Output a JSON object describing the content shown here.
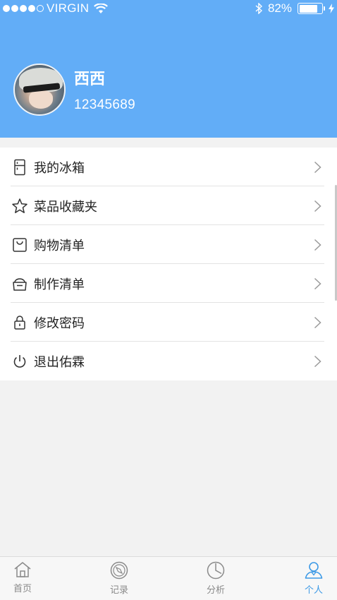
{
  "status_bar": {
    "carrier": "VIRGIN",
    "battery_percent": "82%",
    "battery_level": 0.82
  },
  "profile": {
    "name": "西西",
    "id": "12345689"
  },
  "menu": {
    "items": [
      {
        "label": "我的冰箱",
        "icon": "fridge-icon"
      },
      {
        "label": "菜品收藏夹",
        "icon": "star-icon"
      },
      {
        "label": "购物清单",
        "icon": "shopping-bag-icon"
      },
      {
        "label": "制作清单",
        "icon": "pot-icon"
      },
      {
        "label": "修改密码",
        "icon": "lock-icon"
      },
      {
        "label": "退出佑霖",
        "icon": "power-icon"
      }
    ]
  },
  "tabbar": {
    "tabs": [
      {
        "label": "首页",
        "icon": "home-icon"
      },
      {
        "label": "记录",
        "icon": "compass-icon"
      },
      {
        "label": "分析",
        "icon": "pie-chart-icon"
      },
      {
        "label": "个人",
        "icon": "person-icon",
        "active": true
      }
    ]
  },
  "colors": {
    "header_bg": "#62adf7",
    "accent": "#3d9ae6"
  }
}
